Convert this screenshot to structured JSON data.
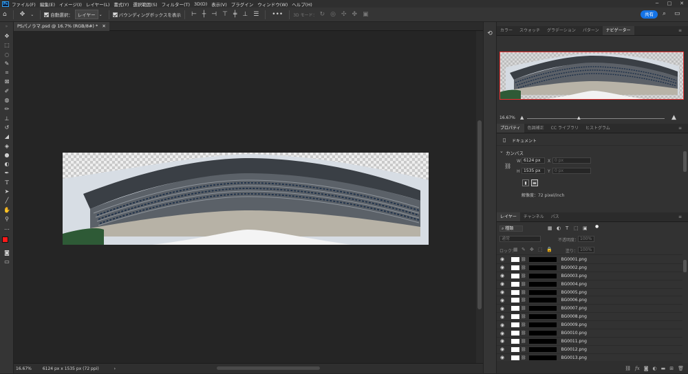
{
  "app": {
    "logo": "Ps"
  },
  "menu": [
    "ファイル(F)",
    "編集(E)",
    "イメージ(I)",
    "レイヤー(L)",
    "書式(Y)",
    "選択範囲(S)",
    "フィルター(T)",
    "3D(D)",
    "表示(V)",
    "プラグイン",
    "ウィンドウ(W)",
    "ヘルプ(H)"
  ],
  "options": {
    "auto_select_label": "自動選択：",
    "auto_select_value": "レイヤー",
    "bbox_label": "バウンディングボックスを表示",
    "mode_3d": "3D モード：",
    "share": "共有"
  },
  "document": {
    "tab_title": "PSパノラマ.psd @ 16.7% (RGB/8#) *",
    "zoom": "16.67%",
    "dims": "6124 px x 1535 px (72 ppi)"
  },
  "tools": [
    "move-tool",
    "artboard-tool",
    "lasso-tool",
    "quick-select-tool",
    "crop-tool",
    "frame-tool",
    "eyedropper-tool",
    "spot-heal-tool",
    "brush-tool",
    "stamp-tool",
    "history-brush-tool",
    "eraser-tool",
    "gradient-tool",
    "blur-tool",
    "dodge-tool",
    "pen-tool",
    "type-tool",
    "path-select-tool",
    "line-tool",
    "hand-tool",
    "zoom-tool",
    "more-tool"
  ],
  "colors": {
    "foreground": "#ff1a1a",
    "background": "#ffffff",
    "accent": "#1473e6",
    "nav_frame": "#e33333"
  },
  "panel_top": {
    "tabs": [
      "カラー",
      "スウォッチ",
      "グラデーション",
      "パターン",
      "ナビゲーター"
    ],
    "active": "ナビゲーター",
    "zoom": "16.67%"
  },
  "panel_props": {
    "tabs": [
      "プロパティ",
      "色調補正",
      "CC ライブラリ",
      "ヒストグラム"
    ],
    "active": "プロパティ",
    "doc_label": "ドキュメント",
    "canvas_label": "カンバス",
    "w_label": "W",
    "w_value": "6124 px",
    "h_label": "H",
    "h_value": "1535 px",
    "x_label": "X",
    "x_value": "0 px",
    "y_label": "Y",
    "y_value": "0 px",
    "resolution": "解像度：72 pixel/inch"
  },
  "panel_layers": {
    "tabs": [
      "レイヤー",
      "チャンネル",
      "パス"
    ],
    "active": "レイヤー",
    "kind": "種類",
    "blend": "通常",
    "opacity_label": "不透明度：",
    "opacity_value": "100%",
    "lock_label": "ロック：",
    "fill_label": "塗り：",
    "fill_value": "100%",
    "layers": [
      "BG0001.png",
      "BG0002.png",
      "BG0003.png",
      "BG0004.png",
      "BG0005.png",
      "BG0006.png",
      "BG0007.png",
      "BG0008.png",
      "BG0009.png",
      "BG0010.png",
      "BG0011.png",
      "BG0012.png",
      "BG0013.png",
      "BG0014.png"
    ]
  }
}
